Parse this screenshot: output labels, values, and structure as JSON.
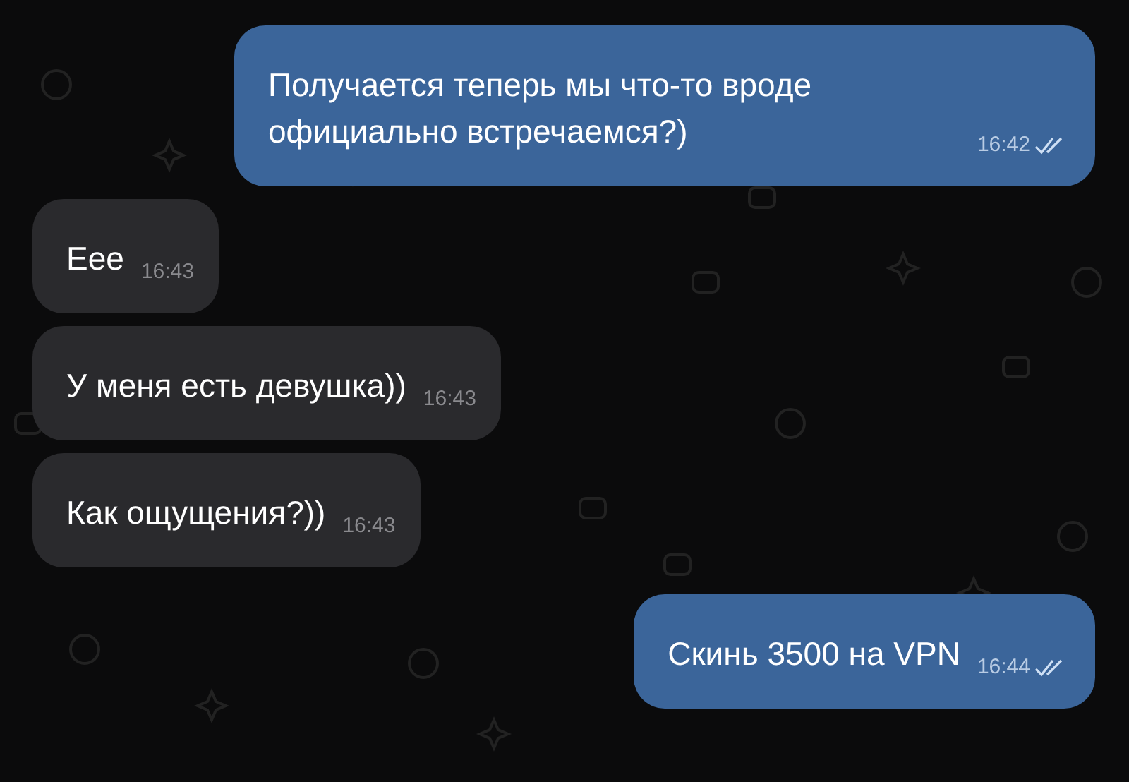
{
  "messages": [
    {
      "kind": "outgoing",
      "text": "Получается теперь мы что-то вроде официально встречаемся?)",
      "time": "16:42",
      "read": true
    },
    {
      "kind": "incoming",
      "text": "Еее",
      "time": "16:43"
    },
    {
      "kind": "incoming",
      "text": "У меня есть девушка))",
      "time": "16:43"
    },
    {
      "kind": "incoming",
      "text": "Как ощущения?))",
      "time": "16:43"
    },
    {
      "kind": "outgoing",
      "text": "Скинь 3500 на VPN",
      "time": "16:44",
      "read": true
    }
  ]
}
